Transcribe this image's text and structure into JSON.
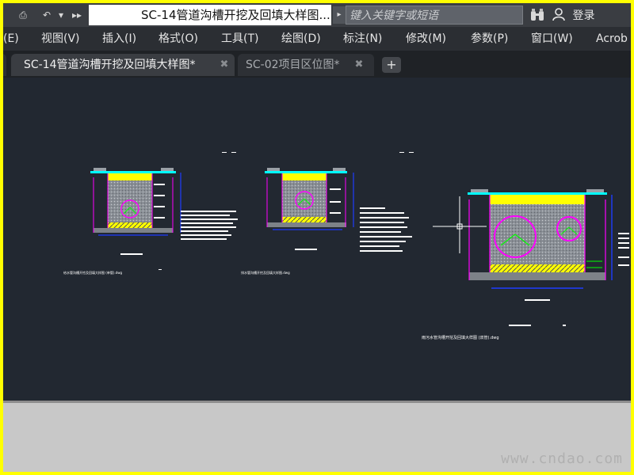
{
  "window": {
    "title": "SC-14管道沟槽开挖及回填大样图....",
    "search_placeholder": "键入关键字或短语",
    "user_label": "登录",
    "expand_icon": "▸",
    "quick_access": [
      "⎙",
      "↶",
      "▾",
      "▸▸"
    ]
  },
  "menu": {
    "items": [
      "(E)",
      "视图(V)",
      "插入(I)",
      "格式(O)",
      "工具(T)",
      "绘图(D)",
      "标注(N)",
      "修改(M)",
      "参数(P)",
      "窗口(W)",
      "Acrob"
    ]
  },
  "tabs": [
    {
      "label": "SC-14管道沟槽开挖及回填大样图*",
      "active": true
    },
    {
      "label": "SC-02项目区位图*",
      "active": false
    }
  ],
  "new_tab_label": "+",
  "close_glyph": "✖",
  "drawing": {
    "labels": [
      "给水管沟槽开挖及回填大样图 (单管).dwg",
      "排水管沟槽开挖及回填大样图.dwg",
      "雨污水管沟槽开挖及回填大样图 (双管).dwg"
    ]
  },
  "watermark": "www.cndao.com",
  "colors": {
    "frame": "#ffff00",
    "canvas": "#222831",
    "magenta": "#ff00ff",
    "yellow": "#ffff00",
    "cyan": "#00ffff",
    "green": "#00ff00",
    "blue": "#1e3cff"
  }
}
